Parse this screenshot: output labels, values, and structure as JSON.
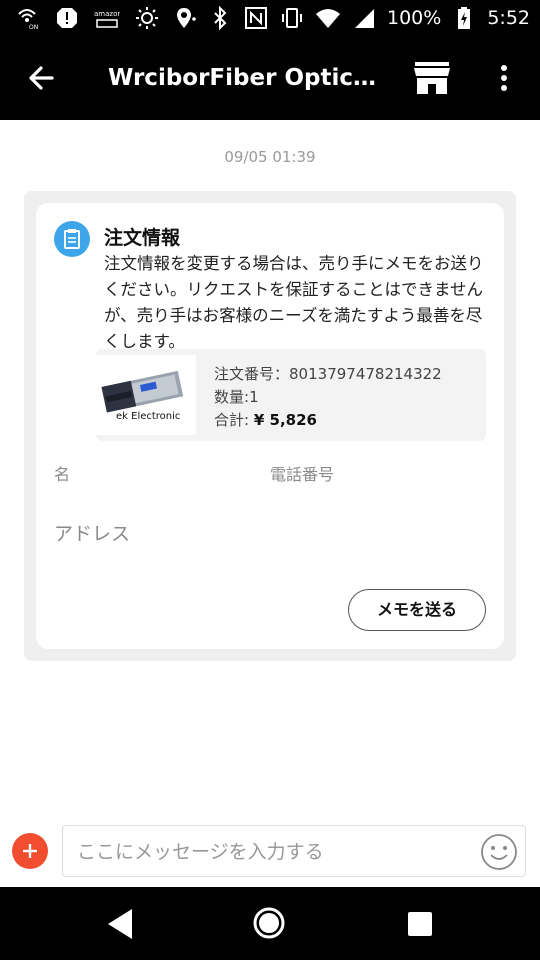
{
  "status_bar": {
    "battery": "100%",
    "time": "5:52",
    "icons": [
      "wifi-calling-icon",
      "alert-icon",
      "amazon-icon",
      "brightness-icon",
      "more-dots-icon",
      "location-icon",
      "bluetooth-icon",
      "nfc-icon",
      "vibrate-icon",
      "wifi-icon",
      "signal-icon",
      "battery-icon"
    ]
  },
  "app_bar": {
    "title": "WrciborFiber Optical...",
    "icons": [
      "back-arrow-icon",
      "store-icon",
      "more-vert-icon"
    ]
  },
  "chat": {
    "timestamp": "09/05 01:39",
    "order_card": {
      "title": "注文情報",
      "description": "注文情報を変更する場合は、売り手にメモをお送りください。リクエストを保証することはできませんが、売り手はお客様のニーズを満たすよう最善を尽くします。",
      "product": {
        "image_text": "ek Electronic",
        "order_number_label": "注文番号：",
        "order_number": "8013797478214322",
        "quantity_label": "数量:",
        "quantity": "1",
        "total_label": "合計:",
        "total": "¥ 5,826"
      },
      "name_label": "名",
      "phone_label": "電話番号",
      "address_label": "アドレス",
      "memo_button": "メモを送る"
    }
  },
  "input_bar": {
    "placeholder": "ここにメッセージを入力する"
  },
  "colors": {
    "accent_blue": "#3ea5ea",
    "plus_red": "#f04e2e",
    "bar_black": "#000000"
  }
}
